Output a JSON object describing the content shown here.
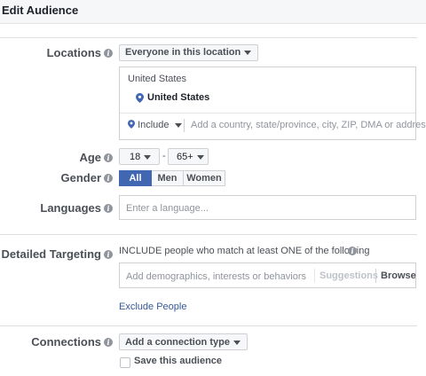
{
  "header": {
    "title": "Edit Audience"
  },
  "locations": {
    "label": "Locations",
    "scope_dropdown": "Everyone in this location",
    "group_title": "United States",
    "selected": "United States",
    "include_dropdown": "Include",
    "search_placeholder": "Add a country, state/province, city, ZIP, DMA or address"
  },
  "age": {
    "label": "Age",
    "min": "18",
    "separator": "-",
    "max": "65+"
  },
  "gender": {
    "label": "Gender",
    "options": [
      "All",
      "Men",
      "Women"
    ],
    "selected": "All"
  },
  "languages": {
    "label": "Languages",
    "placeholder": "Enter a language..."
  },
  "detailed_targeting": {
    "label": "Detailed Targeting",
    "instruction": "INCLUDE people who match at least ONE of the following",
    "placeholder": "Add demographics, interests or behaviors",
    "suggestions": "Suggestions",
    "browse": "Browse",
    "exclude_link": "Exclude People"
  },
  "connections": {
    "label": "Connections",
    "dropdown": "Add a connection type",
    "save_checkbox": "Save this audience",
    "save_checked": false
  },
  "colors": {
    "accent": "#4267b2",
    "link": "#365899",
    "border": "#ced0d4",
    "label": "#4b4f56"
  },
  "icons": {
    "info": "info-icon",
    "pin": "map-pin-icon",
    "caret": "caret-down-icon"
  }
}
